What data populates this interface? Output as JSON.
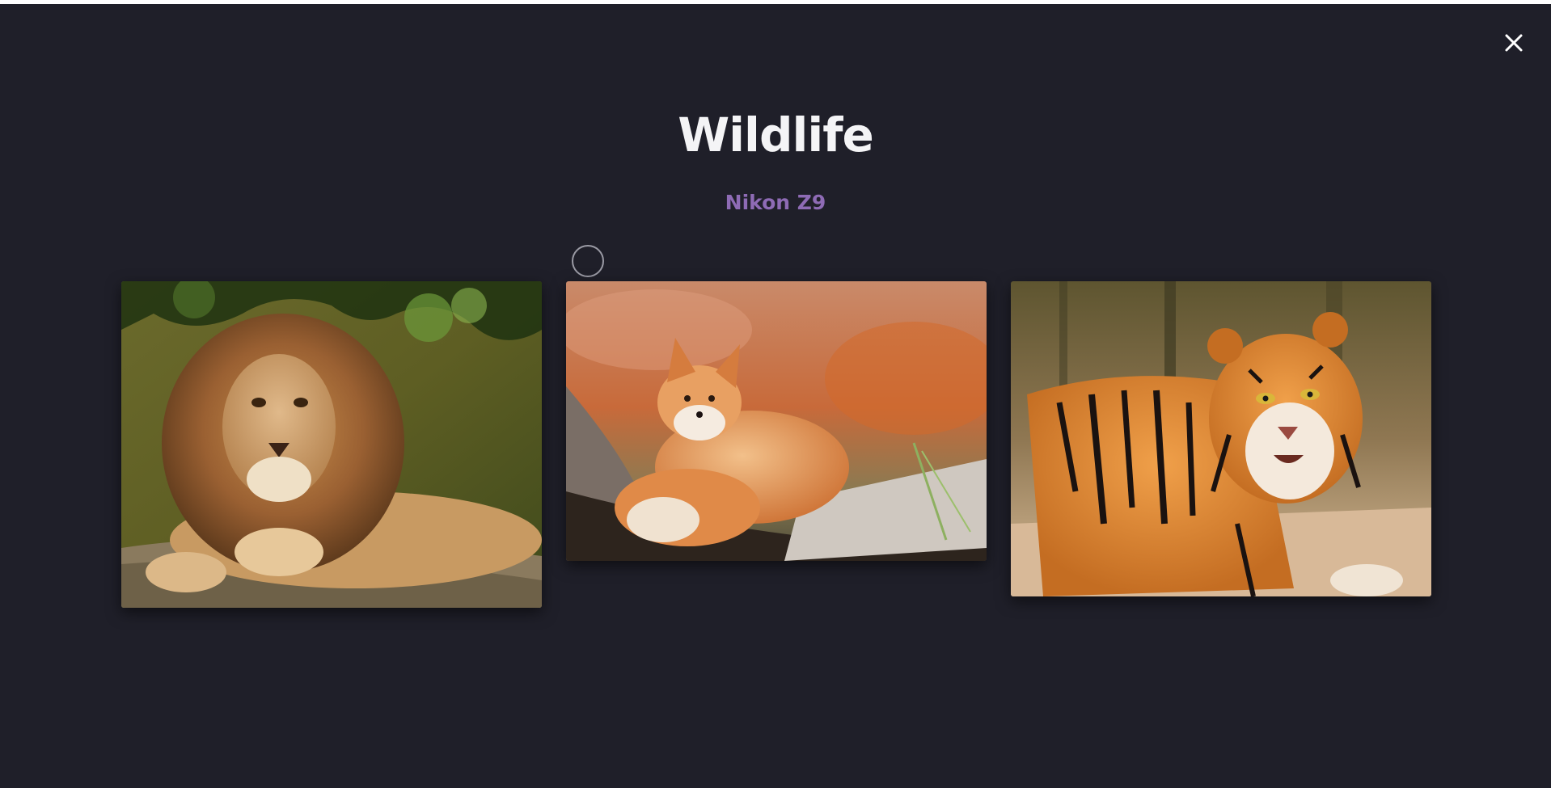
{
  "gallery": {
    "title": "Wildlife",
    "subtitle": "Nikon Z9",
    "close_icon": "close-icon",
    "photos": [
      {
        "subject": "lion",
        "icon": "lion-photo"
      },
      {
        "subject": "fox",
        "icon": "fox-photo"
      },
      {
        "subject": "tiger",
        "icon": "tiger-photo"
      }
    ]
  },
  "colors": {
    "background": "#1f1f29",
    "title": "#f4f4f6",
    "subtitle": "#8e6bb5"
  }
}
